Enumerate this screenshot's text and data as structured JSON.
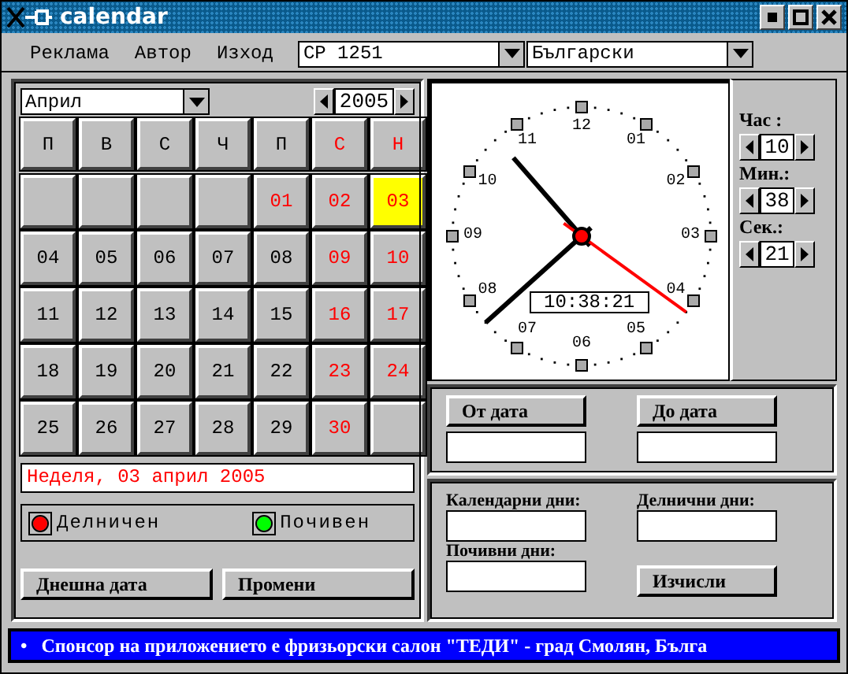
{
  "window": {
    "title": "calendar"
  },
  "menu": [
    "Реклама",
    "Автор",
    "Изход"
  ],
  "encoding": {
    "value": "CP 1251"
  },
  "language": {
    "value": "Български"
  },
  "month": {
    "value": "Април"
  },
  "year": {
    "value": "2005"
  },
  "weekdays": [
    {
      "label": "П",
      "holiday": false
    },
    {
      "label": "В",
      "holiday": false
    },
    {
      "label": "С",
      "holiday": false
    },
    {
      "label": "Ч",
      "holiday": false
    },
    {
      "label": "П",
      "holiday": false
    },
    {
      "label": "С",
      "holiday": true
    },
    {
      "label": "Н",
      "holiday": true
    }
  ],
  "days": [
    {
      "kind": "blank"
    },
    {
      "kind": "blank"
    },
    {
      "kind": "blank"
    },
    {
      "kind": "blank"
    },
    {
      "kind": "day",
      "label": "01",
      "holiday": true,
      "selected": false
    },
    {
      "kind": "day",
      "label": "02",
      "holiday": true,
      "selected": false
    },
    {
      "kind": "day",
      "label": "03",
      "holiday": true,
      "selected": true
    },
    {
      "kind": "day",
      "label": "04",
      "holiday": false,
      "selected": false
    },
    {
      "kind": "day",
      "label": "05",
      "holiday": false,
      "selected": false
    },
    {
      "kind": "day",
      "label": "06",
      "holiday": false,
      "selected": false
    },
    {
      "kind": "day",
      "label": "07",
      "holiday": false,
      "selected": false
    },
    {
      "kind": "day",
      "label": "08",
      "holiday": false,
      "selected": false
    },
    {
      "kind": "day",
      "label": "09",
      "holiday": true,
      "selected": false
    },
    {
      "kind": "day",
      "label": "10",
      "holiday": true,
      "selected": false
    },
    {
      "kind": "day",
      "label": "11",
      "holiday": false,
      "selected": false
    },
    {
      "kind": "day",
      "label": "12",
      "holiday": false,
      "selected": false
    },
    {
      "kind": "day",
      "label": "13",
      "holiday": false,
      "selected": false
    },
    {
      "kind": "day",
      "label": "14",
      "holiday": false,
      "selected": false
    },
    {
      "kind": "day",
      "label": "15",
      "holiday": false,
      "selected": false
    },
    {
      "kind": "day",
      "label": "16",
      "holiday": true,
      "selected": false
    },
    {
      "kind": "day",
      "label": "17",
      "holiday": true,
      "selected": false
    },
    {
      "kind": "day",
      "label": "18",
      "holiday": false,
      "selected": false
    },
    {
      "kind": "day",
      "label": "19",
      "holiday": false,
      "selected": false
    },
    {
      "kind": "day",
      "label": "20",
      "holiday": false,
      "selected": false
    },
    {
      "kind": "day",
      "label": "21",
      "holiday": false,
      "selected": false
    },
    {
      "kind": "day",
      "label": "22",
      "holiday": false,
      "selected": false
    },
    {
      "kind": "day",
      "label": "23",
      "holiday": true,
      "selected": false
    },
    {
      "kind": "day",
      "label": "24",
      "holiday": true,
      "selected": false
    },
    {
      "kind": "day",
      "label": "25",
      "holiday": false,
      "selected": false
    },
    {
      "kind": "day",
      "label": "26",
      "holiday": false,
      "selected": false
    },
    {
      "kind": "day",
      "label": "27",
      "holiday": false,
      "selected": false
    },
    {
      "kind": "day",
      "label": "28",
      "holiday": false,
      "selected": false
    },
    {
      "kind": "day",
      "label": "29",
      "holiday": false,
      "selected": false
    },
    {
      "kind": "day",
      "label": "30",
      "holiday": true,
      "selected": false
    },
    {
      "kind": "blank"
    }
  ],
  "date_line": "Неделя, 03 април 2005",
  "legend": [
    {
      "label": "Делничен",
      "color": "#ff0000"
    },
    {
      "label": "Почивен",
      "color": "#00ff00"
    }
  ],
  "buttons": [
    "Днешна дата",
    "Промени"
  ],
  "clock": {
    "numbers": [
      "12",
      "01",
      "02",
      "03",
      "04",
      "05",
      "06",
      "07",
      "08",
      "09",
      "10",
      "11"
    ],
    "time": "10:38:21"
  },
  "time_spinners": [
    {
      "label": "Час :",
      "value": "10"
    },
    {
      "label": "Мин.:",
      "value": "38"
    },
    {
      "label": "Сек.:",
      "value": "21"
    }
  ],
  "range": {
    "from_button": "От дата",
    "to_button": "До дата"
  },
  "results": {
    "calendar_days_label": "Календарни дни:",
    "work_days_label": "Делнични дни:",
    "rest_days_label": "Почивни дни:",
    "calculate_button": "Изчисли"
  },
  "status": "•   Спонсор на приложението е фризьорски салон \"ТЕДИ\" - град Смолян, Бълга"
}
